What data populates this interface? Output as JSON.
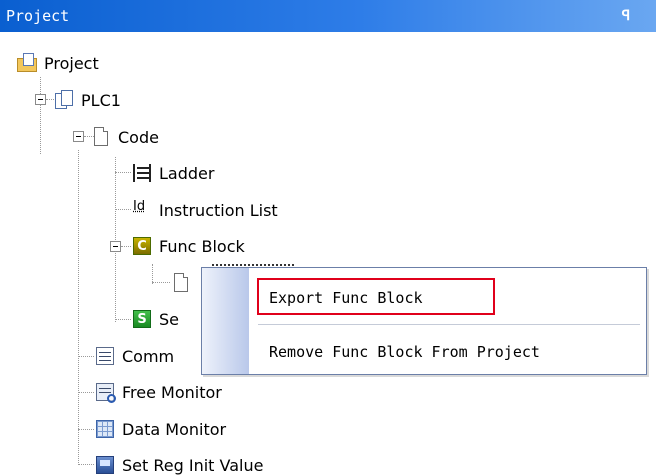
{
  "panel": {
    "title": "Project",
    "pin_glyph": "ꟼ"
  },
  "tree": {
    "project": "Project",
    "plc": "PLC1",
    "code": "Code",
    "ladder": "Ladder",
    "instruction_list": "Instruction List",
    "instruction_list_icon_text": "Id",
    "func_block": "Func Block",
    "func_block_icon_text": "C",
    "sequence_partial": "Se",
    "sequence_icon_text": "S",
    "comment_partial": "Comm",
    "free_monitor": "Free Monitor",
    "data_monitor": "Data Monitor",
    "set_reg_init_value": "Set Reg Init Value"
  },
  "context_menu": {
    "items": [
      {
        "label": "Export Func Block",
        "highlighted": true
      },
      {
        "label": "Remove Func Block From Project",
        "highlighted": false
      }
    ]
  },
  "colors": {
    "title_bar": "#0a5fd0",
    "highlight_box": "#e0001b",
    "menu_strip": "#b9c8ea"
  }
}
